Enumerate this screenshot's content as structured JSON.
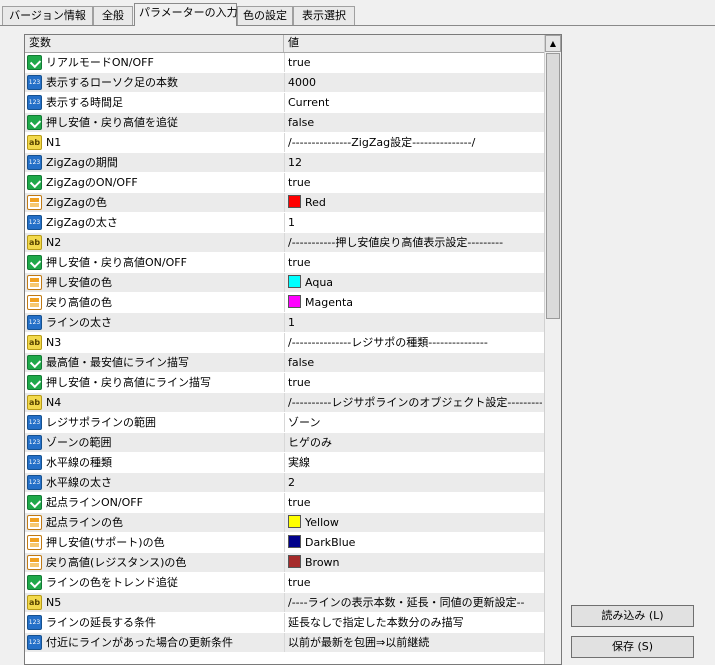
{
  "tabs": [
    {
      "label": "バージョン情報",
      "active": false
    },
    {
      "label": "全般",
      "active": false
    },
    {
      "label": "パラメーターの入力",
      "active": true
    },
    {
      "label": "色の設定",
      "active": false
    },
    {
      "label": "表示選択",
      "active": false
    }
  ],
  "grid": {
    "col_variable": "変数",
    "col_value": "値",
    "rows": [
      {
        "type": "bool",
        "name": "リアルモードON/OFF",
        "value": "true"
      },
      {
        "type": "num",
        "name": "表示するローソク足の本数",
        "value": "4000"
      },
      {
        "type": "num",
        "name": "表示する時間足",
        "value": "Current"
      },
      {
        "type": "bool",
        "name": "押し安値・戻り高値を追従",
        "value": "false"
      },
      {
        "type": "str",
        "name": "N1",
        "value": "/---------------ZigZag設定---------------/"
      },
      {
        "type": "num",
        "name": "ZigZagの期間",
        "value": "12"
      },
      {
        "type": "bool",
        "name": "ZigZagのON/OFF",
        "value": "true"
      },
      {
        "type": "col",
        "name": "ZigZagの色",
        "value": "Red",
        "color": "#ff0000"
      },
      {
        "type": "num",
        "name": "ZigZagの太さ",
        "value": "1"
      },
      {
        "type": "str",
        "name": "N2",
        "value": "/-----------押し安値戻り高値表示設定---------"
      },
      {
        "type": "bool",
        "name": "押し安値・戻り高値ON/OFF",
        "value": "true"
      },
      {
        "type": "col",
        "name": "押し安値の色",
        "value": "Aqua",
        "color": "#00ffff"
      },
      {
        "type": "col",
        "name": "戻り高値の色",
        "value": "Magenta",
        "color": "#ff00ff"
      },
      {
        "type": "num",
        "name": "ラインの太さ",
        "value": "1"
      },
      {
        "type": "str",
        "name": "N3",
        "value": "/---------------レジサポの種類---------------"
      },
      {
        "type": "bool",
        "name": "最高値・最安値にライン描写",
        "value": "false"
      },
      {
        "type": "bool",
        "name": "押し安値・戻り高値にライン描写",
        "value": "true"
      },
      {
        "type": "str",
        "name": "N4",
        "value": "/----------レジサポラインのオブジェクト設定---------"
      },
      {
        "type": "num",
        "name": "レジサポラインの範囲",
        "value": "ゾーン"
      },
      {
        "type": "num",
        "name": "ゾーンの範囲",
        "value": "ヒゲのみ"
      },
      {
        "type": "num",
        "name": "水平線の種類",
        "value": "実線"
      },
      {
        "type": "num",
        "name": "水平線の太さ",
        "value": "2"
      },
      {
        "type": "bool",
        "name": "起点ラインON/OFF",
        "value": "true"
      },
      {
        "type": "col",
        "name": "起点ラインの色",
        "value": "Yellow",
        "color": "#ffff00"
      },
      {
        "type": "col",
        "name": "押し安値(サポート)の色",
        "value": "DarkBlue",
        "color": "#00008b"
      },
      {
        "type": "col",
        "name": "戻り高値(レジスタンス)の色",
        "value": "Brown",
        "color": "#a52a2a"
      },
      {
        "type": "bool",
        "name": "ラインの色をトレンド追従",
        "value": "true"
      },
      {
        "type": "str",
        "name": "N5",
        "value": "/----ラインの表示本数・延長・同値の更新設定--"
      },
      {
        "type": "num",
        "name": "ラインの延長する条件",
        "value": "延長なしで指定した本数分のみ描写"
      },
      {
        "type": "num",
        "name": "付近にラインがあった場合の更新条件",
        "value": "以前が最新を包囲⇒以前継続"
      }
    ]
  },
  "buttons": {
    "load": "読み込み (L)",
    "save": "保存 (S)"
  }
}
